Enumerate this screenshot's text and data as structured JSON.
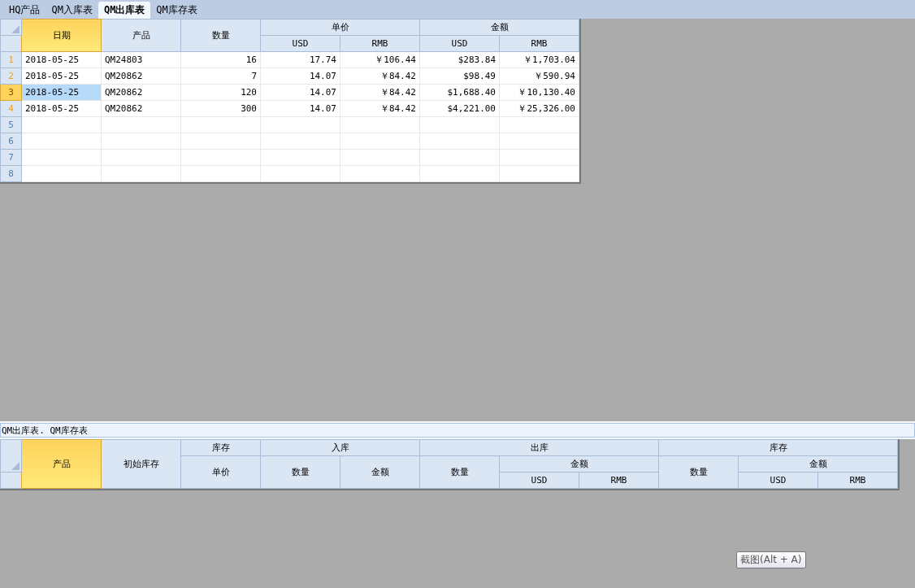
{
  "tabs": [
    {
      "label": "HQ产品",
      "selected": false
    },
    {
      "label": "QM入库表",
      "selected": false
    },
    {
      "label": "QM出库表",
      "selected": true
    },
    {
      "label": "QM库存表",
      "selected": false
    }
  ],
  "sheet": {
    "columns": [
      {
        "label": "日期",
        "selected": true,
        "kind": "text"
      },
      {
        "label": "产品",
        "selected": false,
        "kind": "text"
      },
      {
        "label": "数量",
        "selected": false,
        "kind": "number"
      },
      {
        "label": "单价",
        "selected": false,
        "children": [
          {
            "label": "USD",
            "selected": false,
            "kind": "number"
          },
          {
            "label": "RMB",
            "selected": false,
            "kind": "number"
          }
        ]
      },
      {
        "label": "金额",
        "selected": false,
        "children": [
          {
            "label": "USD",
            "selected": false,
            "kind": "number"
          },
          {
            "label": "RMB",
            "selected": false,
            "kind": "number"
          }
        ]
      }
    ],
    "rows": [
      {
        "number": "1",
        "selected": false,
        "cells": [
          {
            "text": "2018-05-25",
            "selected": false
          },
          {
            "text": "QM24803",
            "selected": false
          },
          {
            "text": "16",
            "selected": false
          },
          {
            "text": "17.74",
            "selected": false
          },
          {
            "text": "￥106.44",
            "selected": false
          },
          {
            "text": "$283.84",
            "selected": false
          },
          {
            "text": "￥1,703.04",
            "selected": false
          }
        ]
      },
      {
        "number": "2",
        "selected": false,
        "cells": [
          {
            "text": "2018-05-25",
            "selected": false
          },
          {
            "text": "QM20862",
            "selected": false
          },
          {
            "text": "7",
            "selected": false
          },
          {
            "text": "14.07",
            "selected": false
          },
          {
            "text": "￥84.42",
            "selected": false
          },
          {
            "text": "$98.49",
            "selected": false
          },
          {
            "text": "￥590.94",
            "selected": false
          }
        ]
      },
      {
        "number": "3",
        "selected": true,
        "cells": [
          {
            "text": "2018-05-25",
            "selected": true
          },
          {
            "text": "QM20862",
            "selected": false
          },
          {
            "text": "120",
            "selected": false
          },
          {
            "text": "14.07",
            "selected": false
          },
          {
            "text": "￥84.42",
            "selected": false
          },
          {
            "text": "$1,688.40",
            "selected": false
          },
          {
            "text": "￥10,130.40",
            "selected": false
          }
        ]
      },
      {
        "number": "4",
        "selected": false,
        "cells": [
          {
            "text": "2018-05-25",
            "selected": false
          },
          {
            "text": "QM20862",
            "selected": false
          },
          {
            "text": "300",
            "selected": false
          },
          {
            "text": "14.07",
            "selected": false
          },
          {
            "text": "￥84.42",
            "selected": false
          },
          {
            "text": "$4,221.00",
            "selected": false
          },
          {
            "text": "￥25,326.00",
            "selected": false
          }
        ]
      },
      {
        "number": "5",
        "selected": false
      },
      {
        "number": "6",
        "selected": false
      },
      {
        "number": "7",
        "selected": false
      },
      {
        "number": "8",
        "selected": false
      }
    ]
  },
  "formula_bar": {
    "value": "QM出库表. QM库存表"
  },
  "report": {
    "columns": [
      {
        "label": "产品",
        "selected": true
      },
      {
        "label": "初始库存",
        "selected": false
      },
      {
        "label": "库存",
        "selected": false,
        "children": [
          {
            "label": "单价",
            "selected": false
          }
        ]
      },
      {
        "label": "入库",
        "selected": false,
        "children": [
          {
            "label": "数量",
            "selected": false
          },
          {
            "label": "金额",
            "selected": false
          }
        ]
      },
      {
        "label": "出库",
        "selected": false,
        "children": [
          {
            "label": "数量",
            "selected": false
          },
          {
            "label": "金额",
            "selected": false,
            "children": [
              {
                "label": "USD",
                "selected": false
              },
              {
                "label": "RMB",
                "selected": false
              }
            ]
          }
        ]
      },
      {
        "label": "库存",
        "selected": false,
        "children": [
          {
            "label": "数量",
            "selected": false
          },
          {
            "label": "金额",
            "selected": false,
            "children": [
              {
                "label": "USD",
                "selected": false
              },
              {
                "label": "RMB",
                "selected": false
              }
            ]
          }
        ]
      }
    ]
  },
  "tooltip": {
    "text": "截图(Alt + A)"
  }
}
